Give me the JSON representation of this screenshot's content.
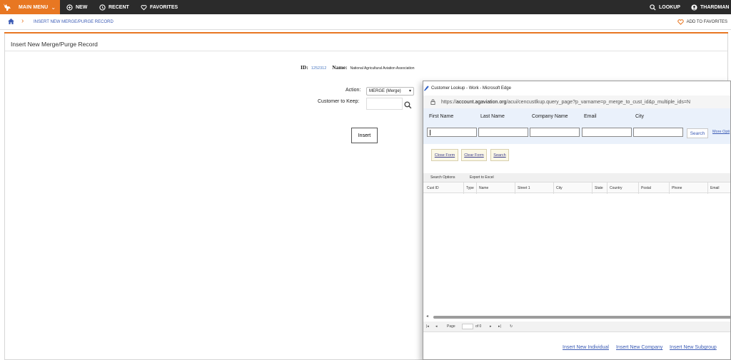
{
  "topbar": {
    "main_menu": "MAIN MENU",
    "new": "NEW",
    "recent": "RECENT",
    "favorites": "FAVORITES",
    "lookup": "LOOKUP",
    "user": "THARDMAN"
  },
  "breadcrumb": {
    "current": "INSERT NEW MERGE/PURGE RECORD",
    "add_to_favorites": "ADD TO FAVORITES"
  },
  "page": {
    "title": "Insert New Merge/Purge Record",
    "id_label": "ID:",
    "id_value": "1252312",
    "name_label": "Name:",
    "name_value": "National Agricultural Aviation Association",
    "action_label": "Action:",
    "action_value": "MERGE (Merge)",
    "customer_keep_label": "Customer to Keep:",
    "customer_keep_value": "",
    "insert_button": "Insert"
  },
  "popup": {
    "window_title": "Customer Lookup - Work - Microsoft Edge",
    "url_prefix": "https://",
    "url_domain": "account.agaviation.org",
    "url_path": "/acui/cencustlkup.query_page?p_varname=p_merge_to_cust_id&p_multiple_ids=N",
    "fields": {
      "first_name": "First Name",
      "last_name": "Last Name",
      "company_name": "Company Name",
      "email": "Email",
      "city": "City"
    },
    "search_button": "Search",
    "more_options": "More Opti",
    "buttons": {
      "close_form": "Close Form",
      "clear_form": "Clear Form",
      "search": "Search"
    },
    "grid_tools": {
      "search_options": "Search Options",
      "export": "Export to Excel"
    },
    "columns": [
      "Cust ID",
      "Type",
      "Name",
      "Street 1",
      "City",
      "State",
      "Country",
      "Postal",
      "Phone",
      "Email"
    ],
    "pager": {
      "page_label": "Page",
      "of_label": "of 0"
    },
    "links": {
      "individual": "Insert New Individual",
      "company": "Insert New Company",
      "subgroup": "Insert New Subgroup"
    }
  },
  "colors": {
    "brand_orange": "#e87722",
    "topbar_dark": "#2b2b2b",
    "link_blue": "#3b5bb5"
  }
}
